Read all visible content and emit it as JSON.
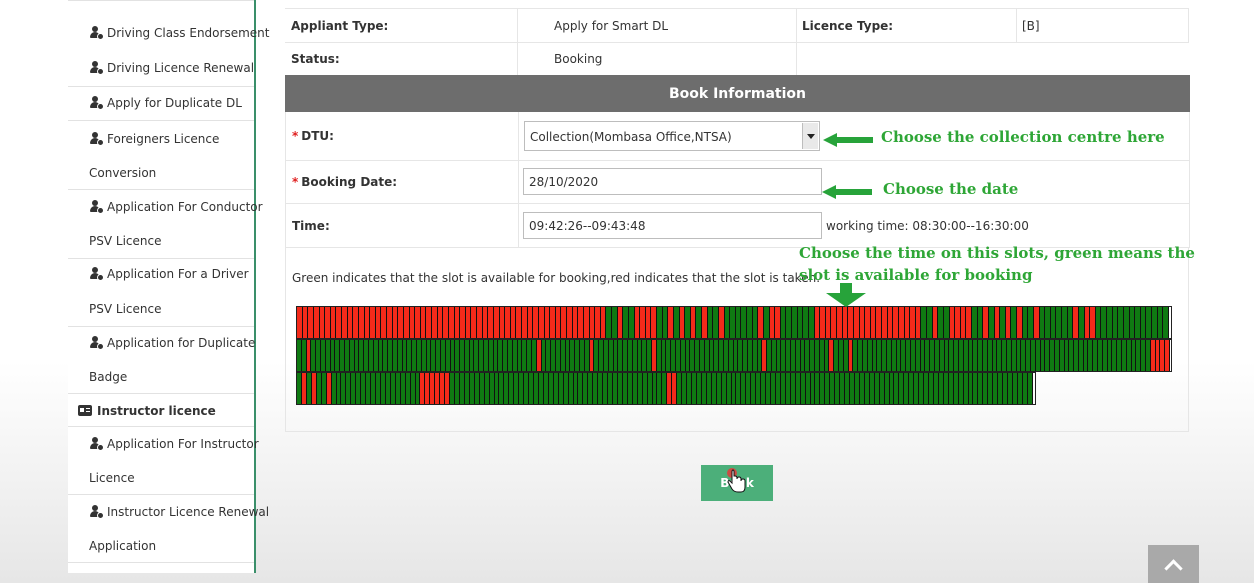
{
  "sidebar": {
    "items": [
      {
        "line1": "Driving Class Endorsement",
        "line2": ""
      },
      {
        "line1": "Driving Licence Renewal",
        "line2": ""
      },
      {
        "line1": "Apply for Duplicate DL",
        "line2": ""
      },
      {
        "line1": "Foreigners Licence",
        "line2": "Conversion"
      },
      {
        "line1": "Application For Conductor",
        "line2": "PSV Licence"
      },
      {
        "line1": "Application For a Driver",
        "line2": "PSV Licence"
      },
      {
        "line1": "Application for Duplicate",
        "line2": "Badge"
      }
    ],
    "section": "Instructor licence",
    "section_items": [
      {
        "line1": "Application For Instructor",
        "line2": "Licence"
      },
      {
        "line1": "Instructor Licence Renewal",
        "line2": "Application"
      }
    ]
  },
  "info": {
    "applicant_type_label": "Appliant Type:",
    "applicant_type_value": "Apply for Smart DL",
    "licence_type_label": "Licence Type:",
    "licence_type_value": "[B]",
    "status_label": "Status:",
    "status_value": "Booking"
  },
  "booking": {
    "header": "Book Information",
    "required_mark": "*",
    "dtu_label": "DTU:",
    "dtu_value": "Collection(Mombasa Office,NTSA)",
    "date_label": "Booking Date:",
    "date_value": "28/10/2020",
    "time_label": "Time:",
    "time_value": "09:42:26--09:43:48",
    "working_time": "working time: 08:30:00--16:30:00",
    "legend_text": "Green indicates that the slot is available for booking,red indicates that the slot is taken.",
    "book_button": "Book"
  },
  "annotations": {
    "collection": "Choose the collection centre here",
    "date": "Choose the date",
    "time_line1": "Choose the time on this slots, green means the",
    "time_line2": "slot is available for booking"
  },
  "slots": {
    "row1": "RRRRRRRRRRRRRRRRRRRRRRRRRRRRRRRRRRRRRRRRRRRRRRRRRRRRRRRGGRGGRRRRGGRGRGRGRGGRGGGGGGRGRRGGGGGGRRRRRRRRRRRRRRRRRRRGGRGGRRRRGGRGRGRGRGGRGGGGGGRGRRGGGGGGGGGGGGG",
    "row2": "GGRGGGGGGGGGGGGGGGGGGGGGGGGGGGGGGGGGGGGGGGGGGGGGGGRGGGGGGGGGGRGGGGGGGGGGGGRGGGGGGGGGGGGGGGGGGGGGGRGGGGGGGGGGGGGRGGGRGGGGGGGGGGGGGGGGGGGGGGGGGGGGGGGGGGGGGGGGGGGGGGGGGGGGGGGGGGGGGGRRRR",
    "row3": "GRGRGGRGGGGGGGGGGGGGGGGGGRRRRRRGGGGGGGGGGGGGGGGGGGGGGGGGGGGGGGGGGGGGGGGGGGGRRGGGGGGGGGGGGGGGGGGGGGGGGGGGGGGGGGGGGGGGGGGGGGGGGGGGGGGGGGGGGGGGGGGGGGGGG"
  },
  "colors": {
    "available": "#0f7a12",
    "taken": "#f42a1a",
    "header_bg": "#6d6d6d",
    "annotation": "#2ea636"
  }
}
